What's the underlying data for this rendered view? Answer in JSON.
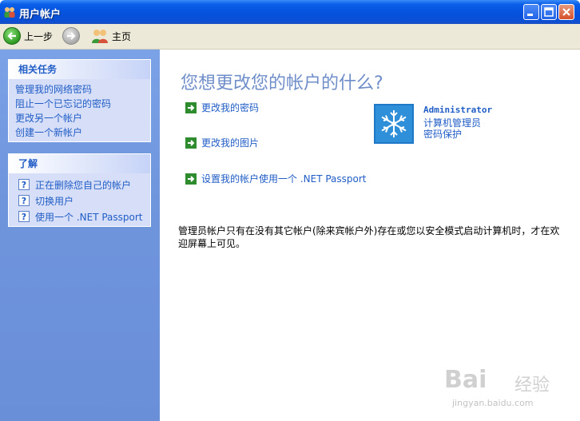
{
  "window": {
    "title": "用户帐户"
  },
  "toolbar": {
    "back_label": "上一步",
    "home_label": "主页"
  },
  "sidebar": {
    "related_tasks": {
      "header": "相关任务",
      "items": [
        "管理我的网络密码",
        "阻止一个已忘记的密码",
        "更改另一个帐户",
        "创建一个新帐户"
      ]
    },
    "learn_about": {
      "header": "了解",
      "items": [
        "正在删除您自己的帐户",
        "切换用户",
        "使用一个 .NET Passport"
      ]
    }
  },
  "main": {
    "heading": "您想更改您的帐户的什么?",
    "actions": [
      "更改我的密码",
      "更改我的图片",
      "设置我的帐户使用一个 .NET Passport"
    ],
    "account": {
      "name": "Administrator",
      "type": "计算机管理员",
      "status": "密码保护"
    },
    "note": "管理员帐户只有在没有其它帐户(除来宾帐户外)存在或您以安全模式启动计算机时，才在欢迎屏幕上可见。"
  },
  "watermark": {
    "brand": "Bai",
    "sub": "经验",
    "url": "jingyan.baidu.com"
  },
  "colors": {
    "link": "#215dc6",
    "heading": "#6f8ec9",
    "sidebar": "#6f95dd",
    "titlebar": "#0552dd"
  }
}
